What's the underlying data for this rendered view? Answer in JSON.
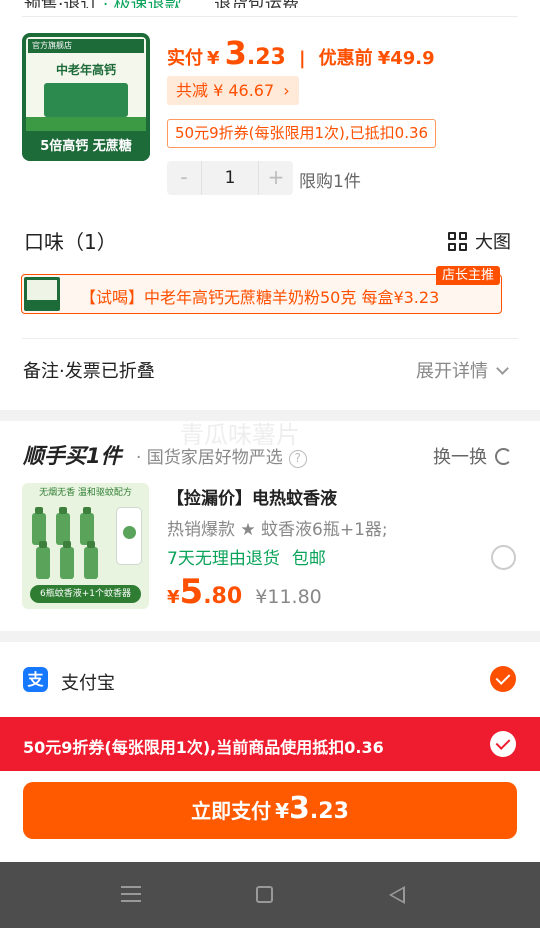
{
  "header_cut": {
    "text_left": "预售·退订",
    "text_green": "· 极速退款",
    "text_right": "退货包运费"
  },
  "product": {
    "image_brand": "官方旗舰店",
    "image_title": "中老年高钙",
    "image_bottom": "5倍高钙 无蔗糖",
    "pay_label": "实付",
    "currency": "¥",
    "pay_int": "3",
    "pay_dec": ".23",
    "sep": "|",
    "orig_label": "优惠前",
    "orig_price": "¥49.9",
    "discount": "共减 ¥ 46.67",
    "coupon": "50元9折券(每张限用1次),已抵扣0.36",
    "qty_minus": "-",
    "qty": "1",
    "qty_plus": "+",
    "limit": "限购1件"
  },
  "flavor": {
    "title": "口味（1）",
    "big_pic_label": "大图",
    "sku_text": "【试喝】中老年高钙无蔗糖羊奶粉50克  每盒¥3.23",
    "sku_badge": "店长主推"
  },
  "remark": {
    "label": "备注·发票已折叠",
    "expand": "展开详情"
  },
  "addon": {
    "title": "顺手买1件",
    "subtitle": "· 国货家居好物严选",
    "qmark": "?",
    "swap": "换一换",
    "watermark": "青瓜味薯片",
    "img_header": "无烟无香 温和驱蚊配方",
    "img_bottom": "6瓶蚊香液+1个蚊香器",
    "name": "【捡漏价】电热蚊香液",
    "spec": "热销爆款 ★ 蚊香液6瓶+1器;",
    "service1": "7天无理由退货",
    "service2": "包邮",
    "currency": "¥",
    "price_int": "5",
    "price_dec": ".80",
    "old_price": "¥11.80"
  },
  "payment": {
    "alipay_icon": "支",
    "alipay": "支付宝",
    "red_notice": "50元9折券(每张限用1次),当前商品使用抵扣0.36",
    "button_label": "立即支付",
    "currency": "¥",
    "btn_int": "3",
    "btn_dec": ".23"
  },
  "colors": {
    "accent": "#ff5000",
    "green": "#0aa35a",
    "red_bar": "#ee1c2e",
    "alipay": "#1677ff"
  }
}
